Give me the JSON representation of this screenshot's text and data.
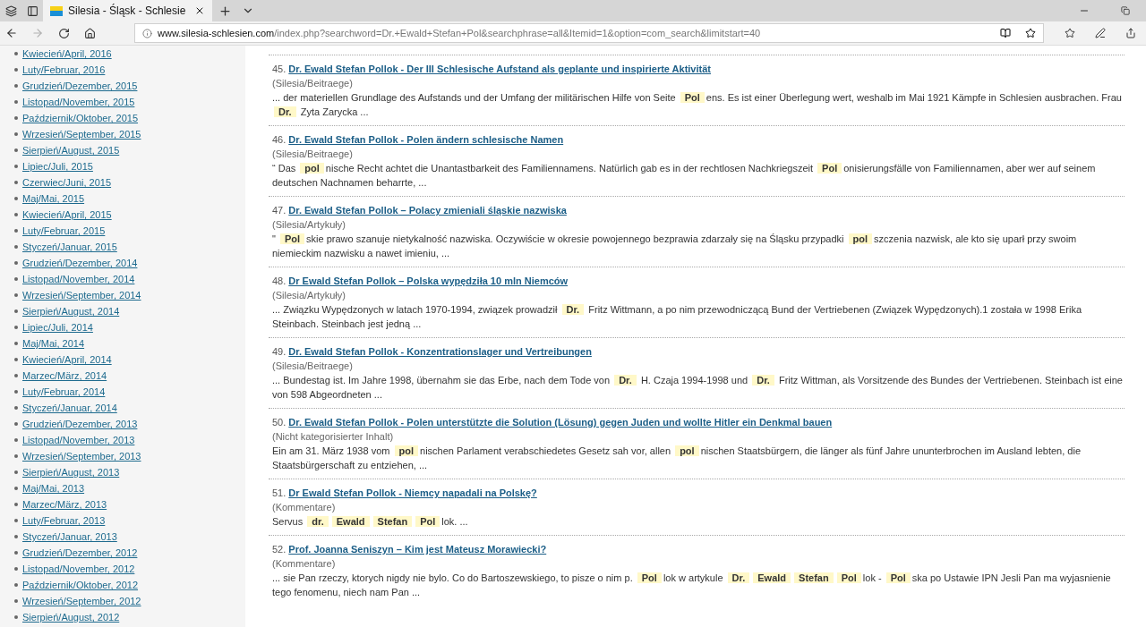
{
  "browser": {
    "tab": {
      "title": "Silesia - Śląsk - Schlesie"
    },
    "address": {
      "domain": "www.silesia-schlesien.com",
      "path": "/index.php?searchword=Dr.+Ewald+Stefan+Pol&searchphrase=all&Itemid=1&option=com_search&limitstart=40"
    },
    "forward_disabled": true
  },
  "sidebar": {
    "items": [
      "Kwiecień/April, 2016",
      "Luty/Februar, 2016",
      "Grudzień/Dezember, 2015",
      "Listopad/November, 2015",
      "Październik/Oktober, 2015",
      "Wrzesień/September, 2015",
      "Sierpień/August, 2015",
      "Lipiec/Juli, 2015",
      "Czerwiec/Juni, 2015",
      "Maj/Mai, 2015",
      "Kwiecień/April, 2015",
      "Luty/Februar, 2015",
      "Styczeń/Januar, 2015",
      "Grudzień/Dezember, 2014",
      "Listopad/November, 2014",
      "Wrzesień/September, 2014",
      "Sierpień/August, 2014",
      "Lipiec/Juli, 2014",
      "Maj/Mai, 2014",
      "Kwiecień/April, 2014",
      "Marzec/März, 2014",
      "Luty/Februar, 2014",
      "Styczeń/Januar, 2014",
      "Grudzień/Dezember, 2013",
      "Listopad/November, 2013",
      "Wrzesień/September, 2013",
      "Sierpień/August, 2013",
      "Maj/Mai, 2013",
      "Marzec/März, 2013",
      "Luty/Februar, 2013",
      "Styczeń/Januar, 2013",
      "Grudzień/Dezember, 2012",
      "Listopad/November, 2012",
      "Październik/Oktober, 2012",
      "Wrzesień/September, 2012",
      "Sierpień/August, 2012"
    ]
  },
  "results": [
    {
      "number": "45.",
      "title": "Dr. Ewald Stefan Pollok - Der III Schlesische Aufstand als geplante und inspirierte Aktivität",
      "category": "(Silesia/Beitraege)",
      "snippet": [
        {
          "t": "... der materiellen Grundlage des Aufstands und der Umfang der militärischen Hilfe von Seite ",
          "hl": false
        },
        {
          "t": "Pol",
          "hl": true
        },
        {
          "t": "ens. Es ist einer Überlegung wert, weshalb im Mai 1921 Kämpfe in Schlesien ausbrachen. Frau ",
          "hl": false
        },
        {
          "t": "Dr.",
          "hl": true
        },
        {
          "t": " Zyta Zarycka ...",
          "hl": false
        }
      ]
    },
    {
      "number": "46.",
      "title": "Dr. Ewald Stefan Pollok - Polen ändern schlesische Namen",
      "category": "(Silesia/Beitraege)",
      "snippet": [
        {
          "t": "“ Das ",
          "hl": false
        },
        {
          "t": "pol",
          "hl": true
        },
        {
          "t": "nische Recht achtet die Unantastbarkeit des Familiennamens. Natürlich gab es in der rechtlosen Nachkriegszeit ",
          "hl": false
        },
        {
          "t": "Pol",
          "hl": true
        },
        {
          "t": "onisierungsfälle von Familiennamen, aber wer auf seinem deutschen Nachnamen beharrte, ...",
          "hl": false
        }
      ]
    },
    {
      "number": "47.",
      "title": "Dr. Ewald Stefan Pollok – Polacy zmieniali śląskie nazwiska",
      "category": "(Silesia/Artykuły)",
      "snippet": [
        {
          "t": "\" ",
          "hl": false
        },
        {
          "t": "Pol",
          "hl": true
        },
        {
          "t": "skie prawo szanuje nietykalność nazwiska. Oczywiście w okresie powojennego bezprawia zdarzały się na Śląsku przypadki ",
          "hl": false
        },
        {
          "t": "pol",
          "hl": true
        },
        {
          "t": "szczenia nazwisk, ale kto się uparł przy swoim niemieckim nazwisku a nawet imieniu, ...",
          "hl": false
        }
      ]
    },
    {
      "number": "48.",
      "title": "Dr Ewald Stefan Pollok – Polska wypędziła 10 mln Niemców",
      "category": "(Silesia/Artykuły)",
      "snippet": [
        {
          "t": "... Związku Wypędzonych w latach 1970-1994, związek prowadził ",
          "hl": false
        },
        {
          "t": "Dr.",
          "hl": true
        },
        {
          "t": " Fritz Wittmann, a po nim przewodniczącą Bund der Vertriebenen (Związek Wypędzonych).1 została w 1998 Erika Steinbach. Steinbach jest jedną ...",
          "hl": false
        }
      ]
    },
    {
      "number": "49.",
      "title": "Dr. Ewald Stefan Pollok - Konzentrationslager und Vertreibungen",
      "category": "(Silesia/Beitraege)",
      "snippet": [
        {
          "t": "... Bundestag ist. Im Jahre 1998, übernahm sie das Erbe, nach dem Tode von ",
          "hl": false
        },
        {
          "t": "Dr.",
          "hl": true
        },
        {
          "t": " H. Czaja 1994-1998 und ",
          "hl": false
        },
        {
          "t": "Dr.",
          "hl": true
        },
        {
          "t": " Fritz Wittman, als Vorsitzende des Bundes der Vertriebenen. Steinbach ist eine von 598 Abgeordneten ...",
          "hl": false
        }
      ]
    },
    {
      "number": "50.",
      "title": "Dr. Ewald Stefan Pollok - Polen unterstützte die Solution (Lösung) gegen Juden und wollte Hitler ein Denkmal bauen",
      "category": "(Nicht kategorisierter Inhalt)",
      "snippet": [
        {
          "t": "Ein am 31. März 1938 vom ",
          "hl": false
        },
        {
          "t": "pol",
          "hl": true
        },
        {
          "t": "nischen Parlament verabschiedetes Gesetz sah vor, allen ",
          "hl": false
        },
        {
          "t": "pol",
          "hl": true
        },
        {
          "t": "nischen Staatsbürgern, die länger als fünf Jahre ununterbrochen im Ausland lebten, die Staatsbürgerschaft zu entziehen, ...",
          "hl": false
        }
      ]
    },
    {
      "number": "51.",
      "title": "Dr Ewald Stefan Pollok - Niemcy napadali na Polskę?",
      "category": "(Kommentare)",
      "snippet": [
        {
          "t": "Servus ",
          "hl": false
        },
        {
          "t": "dr.",
          "hl": true
        },
        {
          "t": "Ewald",
          "hl": true
        },
        {
          "t": "Stefan",
          "hl": true
        },
        {
          "t": "Pol",
          "hl": true
        },
        {
          "t": "lok. ...",
          "hl": false
        }
      ]
    },
    {
      "number": "52.",
      "title": "Prof. Joanna Seniszyn – Kim jest Mateusz Morawiecki?",
      "category": "(Kommentare)",
      "snippet": [
        {
          "t": "... sie Pan rzeczy, ktorych nigdy nie bylo. Co do Bartoszewskiego, to pisze o nim p. ",
          "hl": false
        },
        {
          "t": "Pol",
          "hl": true
        },
        {
          "t": "lok w artykule ",
          "hl": false
        },
        {
          "t": "Dr.",
          "hl": true
        },
        {
          "t": "Ewald",
          "hl": true
        },
        {
          "t": "Stefan",
          "hl": true
        },
        {
          "t": "Pol",
          "hl": true
        },
        {
          "t": "lok - ",
          "hl": false
        },
        {
          "t": "Pol",
          "hl": true
        },
        {
          "t": "ska po Ustawie IPN Jesli Pan ma wyjasnienie tego fenomenu, niech nam Pan ...",
          "hl": false
        }
      ]
    }
  ]
}
